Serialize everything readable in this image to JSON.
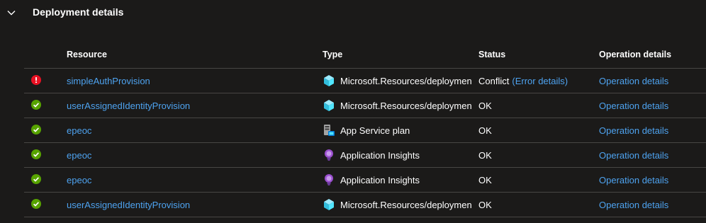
{
  "section": {
    "title": "Deployment details"
  },
  "columns": {
    "resource": "Resource",
    "type": "Type",
    "status": "Status",
    "operation": "Operation details"
  },
  "rows": [
    {
      "state": "error",
      "resource": "simpleAuthProvision",
      "type_icon": "deployment-cube-icon",
      "type": "Microsoft.Resources/deployments",
      "status": "Conflict",
      "status_link": "(Error details)",
      "operation": "Operation details"
    },
    {
      "state": "success",
      "resource": "userAssignedIdentityProvision",
      "type_icon": "deployment-cube-icon",
      "type": "Microsoft.Resources/deployments",
      "status": "OK",
      "status_link": "",
      "operation": "Operation details"
    },
    {
      "state": "success",
      "resource": "epeoc",
      "type_icon": "app-service-plan-icon",
      "type": "App Service plan",
      "status": "OK",
      "status_link": "",
      "operation": "Operation details"
    },
    {
      "state": "success",
      "resource": "epeoc",
      "type_icon": "application-insights-icon",
      "type": "Application Insights",
      "status": "OK",
      "status_link": "",
      "operation": "Operation details"
    },
    {
      "state": "success",
      "resource": "epeoc",
      "type_icon": "application-insights-icon",
      "type": "Application Insights",
      "status": "OK",
      "status_link": "",
      "operation": "Operation details"
    },
    {
      "state": "success",
      "resource": "userAssignedIdentityProvision",
      "type_icon": "deployment-cube-icon",
      "type": "Microsoft.Resources/deployments",
      "status": "OK",
      "status_link": "",
      "operation": "Operation details"
    }
  ],
  "colors": {
    "background": "#1b1a19",
    "link": "#4ea3f0",
    "error": "#e81123",
    "success": "#57a300",
    "divider": "#484644"
  }
}
